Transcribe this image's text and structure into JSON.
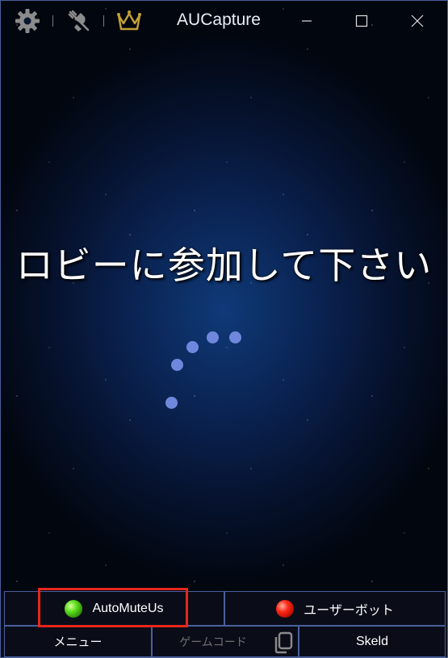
{
  "titlebar": {
    "app_title": "AUCapture",
    "icons": [
      "gear-icon",
      "unplugged-icon",
      "crown-icon"
    ],
    "controls": [
      "minimize-icon",
      "maximize-icon",
      "close-icon"
    ]
  },
  "main": {
    "status_message": "ロビーに参加して下さい"
  },
  "bottom_bar": {
    "row1": {
      "automuteus": {
        "label": "AutoMuteUs",
        "status_color": "#44cc11"
      },
      "userbot": {
        "label": "ユーザーボット",
        "status_color": "#e01a0a"
      }
    },
    "row2": {
      "menu": {
        "label": "メニュー"
      },
      "game_code": {
        "placeholder": "ゲームコード"
      },
      "copy_icon": "copy-icon",
      "map": {
        "label": "Skeld"
      }
    }
  },
  "colors": {
    "border": "#4a5f9c",
    "spinner": "#6f88de",
    "highlight": "#e8261c"
  }
}
